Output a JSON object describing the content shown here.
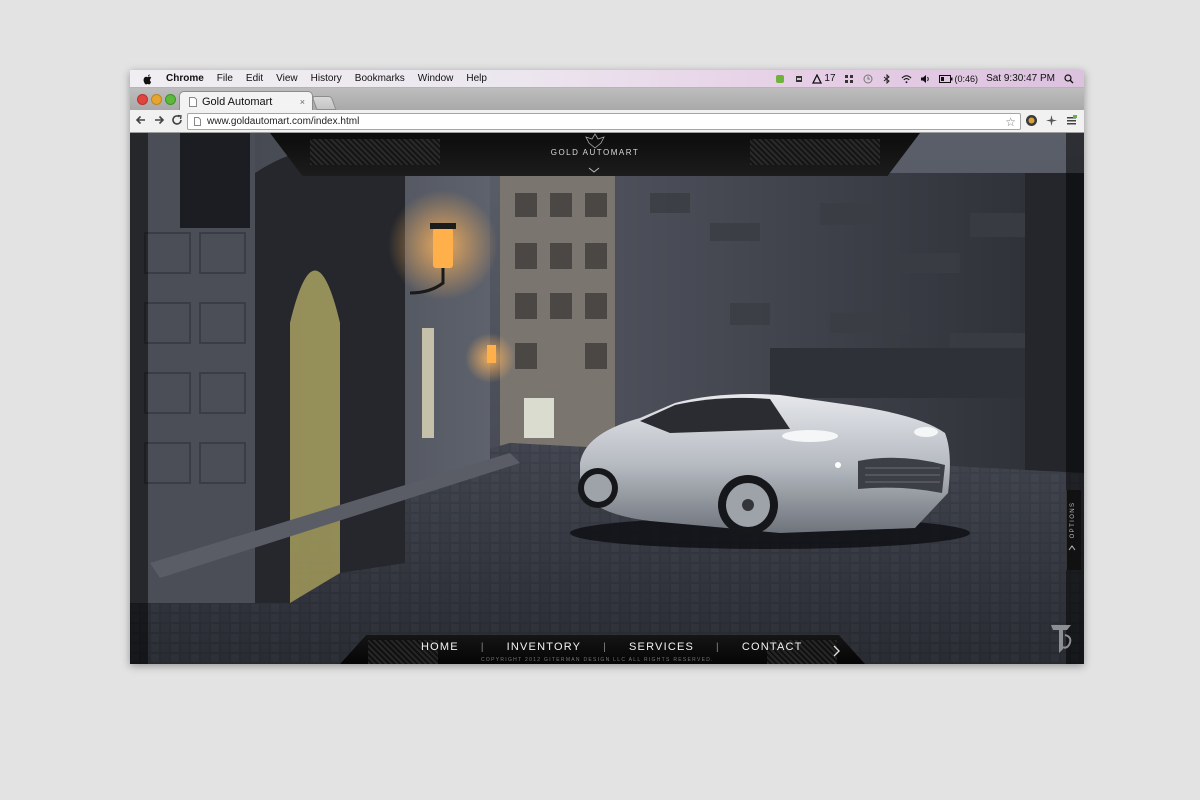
{
  "menubar": {
    "app": "Chrome",
    "items": [
      "File",
      "Edit",
      "View",
      "History",
      "Bookmarks",
      "Window",
      "Help"
    ],
    "status": {
      "notification_count": "17",
      "battery": "(0:46)",
      "clock": "Sat 9:30:47 PM"
    }
  },
  "browser": {
    "tab_title": "Gold Automart",
    "tab_close": "×",
    "url": "www.goldautomart.com/index.html"
  },
  "site": {
    "logo_text": "GOLD AUTOMART",
    "nav": [
      {
        "label": "HOME"
      },
      {
        "label": "INVENTORY"
      },
      {
        "label": "SERVICES"
      },
      {
        "label": "CONTACT"
      }
    ],
    "copyright": "COPYRIGHT 2012 GITERMAN DESIGN LLC ALL RIGHTS RESERVED.",
    "options_label": "OPTIONS"
  },
  "icons": {
    "apple": "apple-icon",
    "star": "bookmark-star-icon",
    "next": "chevron-right-icon"
  },
  "colors": {
    "menubar_accent": "#dcc2df",
    "site_bg": "#2a2c33",
    "car_silver": "#c9ccd1"
  }
}
